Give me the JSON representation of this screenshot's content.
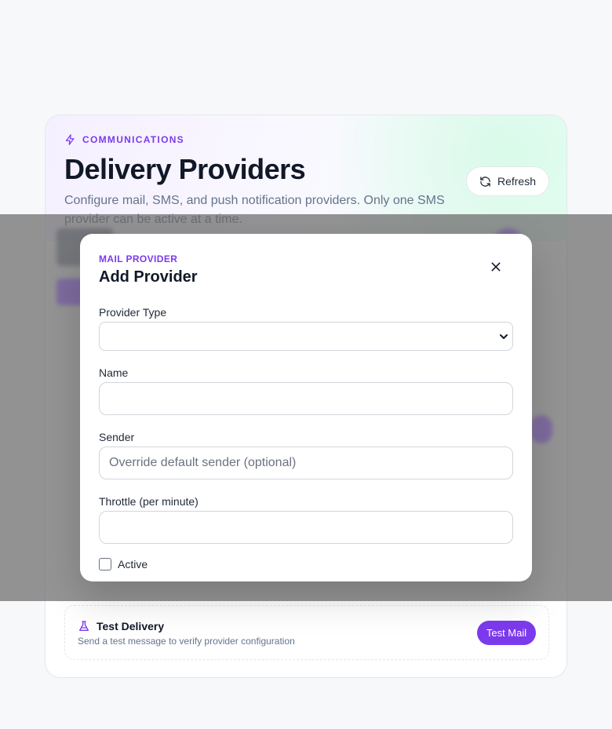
{
  "header": {
    "eyebrow": "COMMUNICATIONS",
    "title": "Delivery Providers",
    "description": "Configure mail, SMS, and push notification providers. Only one SMS provider can be active at a time.",
    "refresh_label": "Refresh"
  },
  "test_delivery": {
    "title": "Test Delivery",
    "subtitle": "Send a test message to verify provider configuration",
    "button_label": "Test Mail"
  },
  "modal": {
    "eyebrow": "MAIL PROVIDER",
    "title": "Add Provider",
    "fields": {
      "provider_type": {
        "label": "Provider Type",
        "value": ""
      },
      "name": {
        "label": "Name",
        "value": ""
      },
      "sender": {
        "label": "Sender",
        "placeholder": "Override default sender (optional)",
        "value": ""
      },
      "throttle": {
        "label": "Throttle (per minute)",
        "value": ""
      }
    },
    "active": {
      "label": "Active",
      "checked": false
    }
  },
  "colors": {
    "accent": "#7c3aed",
    "overlay": "#6b6b6b",
    "background": "#f7f8fa"
  }
}
